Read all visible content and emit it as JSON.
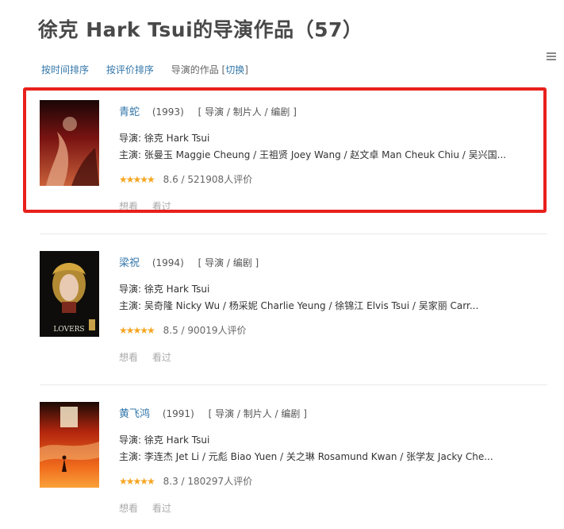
{
  "page_title": "徐克 Hark Tsui的导演作品（57）",
  "sort": {
    "by_time": "按时间排序",
    "by_rating": "按评价排序",
    "roles_label": "导演的作品",
    "switch_open": "[",
    "switch": "切换",
    "switch_close": "]"
  },
  "movies": [
    {
      "title": "青蛇",
      "year": "(1993)",
      "roles": "[ 导演 / 制片人 / 编剧 ]",
      "director": "导演: 徐克 Hark Tsui",
      "cast": "主演: 张曼玉 Maggie Cheung / 王祖贤 Joey Wang / 赵文卓 Man Cheuk Chiu / 吴兴国...",
      "stars": "★★★★★",
      "rating": "8.6 / 521908人评价",
      "want": "想看",
      "seen": "看过"
    },
    {
      "title": "梁祝",
      "year": "(1994)",
      "roles": "[ 导演 / 编剧 ]",
      "director": "导演: 徐克 Hark Tsui",
      "cast": "主演: 吴奇隆 Nicky Wu / 杨采妮 Charlie Yeung / 徐锦江 Elvis Tsui / 吴家丽 Carr...",
      "stars": "★★★★★",
      "rating": "8.5 / 90019人评价",
      "want": "想看",
      "seen": "看过",
      "poster_text": "LOVERS"
    },
    {
      "title": "黄飞鸿",
      "year": "(1991)",
      "roles": "[ 导演 / 制片人 / 编剧 ]",
      "director": "导演: 徐克 Hark Tsui",
      "cast": "主演: 李连杰 Jet Li / 元彪 Biao Yuen / 关之琳 Rosamund Kwan / 张学友 Jacky Che...",
      "stars": "★★★★★",
      "rating": "8.3 / 180297人评价",
      "want": "想看",
      "seen": "看过"
    }
  ],
  "colors": {
    "link": "#3377aa",
    "star": "#f5a623",
    "highlight": "#e8201c"
  },
  "icons": [
    "list-view-icon"
  ]
}
